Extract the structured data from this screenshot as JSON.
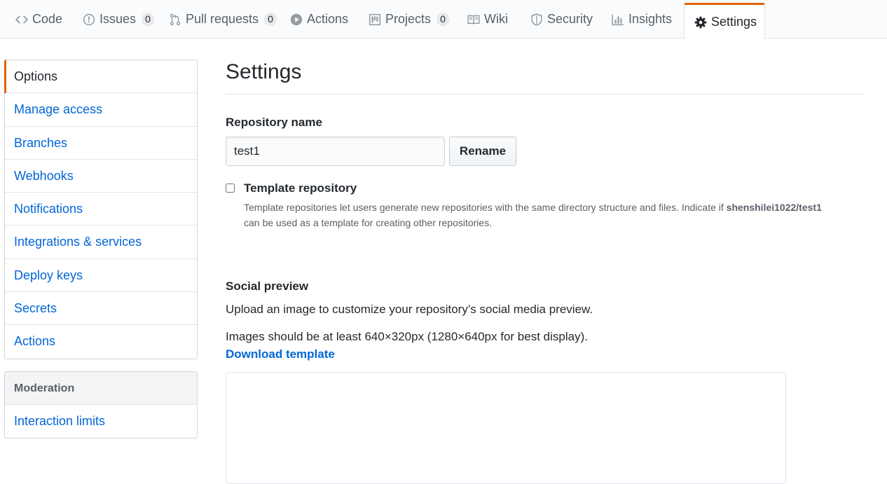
{
  "tabs": [
    {
      "id": "code",
      "label": "Code",
      "icon": "code-icon"
    },
    {
      "id": "issues",
      "label": "Issues",
      "icon": "issue-opened-icon",
      "count": "0"
    },
    {
      "id": "pulls",
      "label": "Pull requests",
      "icon": "git-pull-request-icon",
      "count": "0"
    },
    {
      "id": "actions",
      "label": "Actions",
      "icon": "play-icon"
    },
    {
      "id": "projects",
      "label": "Projects",
      "icon": "project-icon",
      "count": "0"
    },
    {
      "id": "wiki",
      "label": "Wiki",
      "icon": "book-icon"
    },
    {
      "id": "security",
      "label": "Security",
      "icon": "shield-icon"
    },
    {
      "id": "insights",
      "label": "Insights",
      "icon": "graph-icon"
    },
    {
      "id": "settings",
      "label": "Settings",
      "icon": "gear-icon",
      "selected": true
    }
  ],
  "sidebar": {
    "items": [
      {
        "label": "Options",
        "selected": true
      },
      {
        "label": "Manage access"
      },
      {
        "label": "Branches"
      },
      {
        "label": "Webhooks"
      },
      {
        "label": "Notifications"
      },
      {
        "label": "Integrations & services"
      },
      {
        "label": "Deploy keys"
      },
      {
        "label": "Secrets"
      },
      {
        "label": "Actions"
      }
    ],
    "moderation": {
      "heading": "Moderation",
      "items": [
        {
          "label": "Interaction limits"
        }
      ]
    }
  },
  "main": {
    "title": "Settings",
    "repo_name_label": "Repository name",
    "repo_name_value": "test1",
    "rename_label": "Rename",
    "template": {
      "label": "Template repository",
      "checked": false,
      "note_prefix": "Template repositories let users generate new repositories with the same directory structure and files. Indicate if",
      "repo_full": "shenshilei1022/test1",
      "note_suffix": "can be used as a template for creating other repositories."
    },
    "social": {
      "heading": "Social preview",
      "description": "Upload an image to customize your repository’s social media preview.",
      "size_note": "Images should be at least 640×320px (1280×640px for best display).",
      "download_link": "Download template"
    }
  },
  "colors": {
    "accent": "#e36209",
    "link": "#0366d6",
    "text": "#24292e",
    "muted": "#586069",
    "border": "#e1e4e8"
  }
}
